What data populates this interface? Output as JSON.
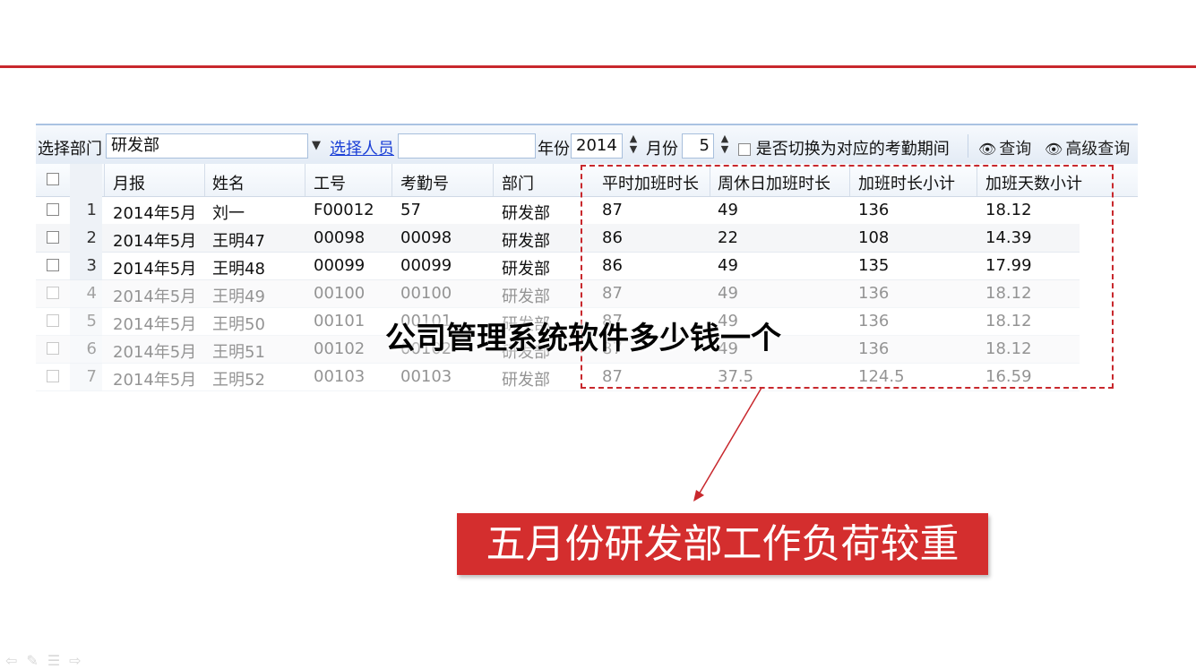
{
  "toolbar": {
    "dept_label": "选择部门",
    "dept_value": "研发部",
    "select_person_link": "选择人员",
    "person_value": "",
    "year_label": "年份",
    "year_value": "2014",
    "month_label": "月份",
    "month_value": "5",
    "switch_label": "是否切换为对应的考勤期间",
    "query_btn": "查询",
    "adv_query_btn": "高级查询"
  },
  "table": {
    "headers": [
      "月报",
      "姓名",
      "工号",
      "考勤号",
      "部门",
      "平时加班时长",
      "周休日加班时长",
      "加班时长小计",
      "加班天数小计"
    ],
    "rows": [
      {
        "n": "1",
        "month": "2014年5月",
        "name": "刘一",
        "id": "F00012",
        "att": "57",
        "dept": "研发部",
        "weekday": "87",
        "weekend": "49",
        "subtotal": "136",
        "days": "18.12"
      },
      {
        "n": "2",
        "month": "2014年5月",
        "name": "王明47",
        "id": "00098",
        "att": "00098",
        "dept": "研发部",
        "weekday": "86",
        "weekend": "22",
        "subtotal": "108",
        "days": "14.39"
      },
      {
        "n": "3",
        "month": "2014年5月",
        "name": "王明48",
        "id": "00099",
        "att": "00099",
        "dept": "研发部",
        "weekday": "86",
        "weekend": "49",
        "subtotal": "135",
        "days": "17.99"
      },
      {
        "n": "4",
        "month": "2014年5月",
        "name": "王明49",
        "id": "00100",
        "att": "00100",
        "dept": "研发部",
        "weekday": "87",
        "weekend": "49",
        "subtotal": "136",
        "days": "18.12"
      },
      {
        "n": "5",
        "month": "2014年5月",
        "name": "王明50",
        "id": "00101",
        "att": "00101",
        "dept": "研发部",
        "weekday": "87",
        "weekend": "49",
        "subtotal": "136",
        "days": "18.12"
      },
      {
        "n": "6",
        "month": "2014年5月",
        "name": "王明51",
        "id": "00102",
        "att": "00102",
        "dept": "研发部",
        "weekday": "87",
        "weekend": "49",
        "subtotal": "136",
        "days": "18.12"
      },
      {
        "n": "7",
        "month": "2014年5月",
        "name": "王明52",
        "id": "00103",
        "att": "00103",
        "dept": "研发部",
        "weekday": "87",
        "weekend": "37.5",
        "subtotal": "124.5",
        "days": "16.59"
      }
    ]
  },
  "overlay_title": "公司管理系统软件多少钱一个",
  "banner_text": "五月份研发部工作负荷较重",
  "colors": {
    "accent": "#c8282d",
    "banner": "#d42e2e",
    "link": "#1a3fd6"
  },
  "icons": [
    "chevron-down-icon",
    "spin-up-icon",
    "spin-down-icon",
    "binoculars-icon",
    "arrow-icon"
  ]
}
